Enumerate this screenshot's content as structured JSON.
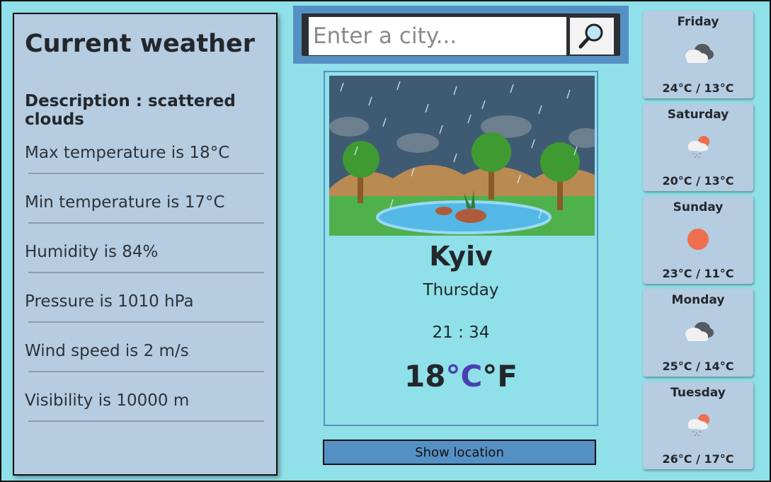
{
  "current": {
    "title": "Current weather",
    "description": "Description : scattered clouds",
    "details": [
      "Max temperature is 18°C",
      "Min temperature is 17°C",
      "Humidity is 84%",
      "Pressure is 1010 hPa",
      "Wind speed is 2 m/s",
      "Visibility is 10000 m"
    ]
  },
  "search": {
    "placeholder": "Enter a city..."
  },
  "main": {
    "city": "Kyiv",
    "day": "Thursday",
    "time": "21 : 34",
    "temp_value": "18",
    "unit_c": "°C",
    "unit_f": "°F",
    "show_location": "Show location"
  },
  "forecast": [
    {
      "day": "Friday",
      "icon": "cloud-icon",
      "temps": "24°C / 13°C"
    },
    {
      "day": "Saturday",
      "icon": "sun-rain-icon",
      "temps": "20°C / 13°C"
    },
    {
      "day": "Sunday",
      "icon": "sun-icon",
      "temps": "23°C / 11°C"
    },
    {
      "day": "Monday",
      "icon": "cloud-icon",
      "temps": "25°C / 14°C"
    },
    {
      "day": "Tuesday",
      "icon": "sun-rain-icon",
      "temps": "26°C / 17°C"
    }
  ],
  "colors": {
    "accent": "#5590c5",
    "background": "#8fe0e8",
    "panel": "#b5cce1",
    "unit_c": "#4a3fb0"
  }
}
